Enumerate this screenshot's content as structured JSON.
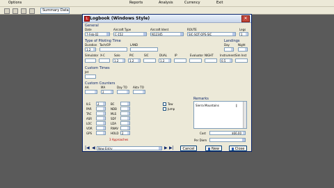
{
  "menubar": {
    "items": [
      "Options",
      "Reports",
      "Analysis",
      "Currency",
      "Exit"
    ]
  },
  "toolbar": {
    "combo_label": "Summary Data"
  },
  "dialog": {
    "title": "Logbook (Windows Style)",
    "general_title": "General",
    "fields": {
      "date_label": "Date",
      "date_value": "7-Feb-02",
      "aircraft_type_label": "Aircraft Type",
      "aircraft_type_value": "C-152",
      "aircraft_ident_label": "Aircraft Ident",
      "aircraft_ident_value": "N12345",
      "route_label": "ROUTE",
      "route_value": "SJC-SQT-OPS-SJC",
      "legs_label": "Legs",
      "legs_value": "1"
    },
    "pilot_time": {
      "title": "Type of Piloting Time",
      "landings_title": "Landings",
      "labels": [
        "Duration",
        "Tach/OP",
        "LAND",
        "Simulator",
        "X-C",
        "Solo",
        "PIC",
        "SIC",
        "DUAL",
        "IP",
        "Evaluator",
        "NIGHT",
        "Instrument",
        "Sim Inst",
        "Day",
        "Night"
      ],
      "values": {
        "duration": "1.2",
        "xc": "",
        "solo": "1.2",
        "pic": "1.2",
        "dual": "1.2",
        "instrument": "0.5",
        "day": "",
        "night": ""
      }
    },
    "custom_times": {
      "title": "Custom Times",
      "label": "Jet"
    },
    "custom_counters": {
      "title": "Custom Counters",
      "labels": [
        "AA",
        "MA",
        "Day TO",
        "Aktv TO"
      ],
      "values": {
        "ma": "2"
      }
    },
    "approaches": {
      "left": [
        {
          "label": "ILS",
          "value": "2"
        },
        {
          "label": "PAR",
          "value": ""
        },
        {
          "label": "TAC",
          "value": ""
        },
        {
          "label": "ASR",
          "value": ""
        },
        {
          "label": "LOC",
          "value": ""
        },
        {
          "label": "VOR",
          "value": ""
        },
        {
          "label": "GPS",
          "value": ""
        }
      ],
      "right": [
        {
          "label": "BC",
          "value": ""
        },
        {
          "label": "NDB",
          "value": ""
        },
        {
          "label": "MLS",
          "value": ""
        },
        {
          "label": "SDF",
          "value": ""
        },
        {
          "label": "LDA",
          "value": ""
        },
        {
          "label": "RNAV",
          "value": ""
        },
        {
          "label": "HOLD",
          "value": "2"
        }
      ],
      "summary": "3 Approaches"
    },
    "checks": {
      "tow": "Tow",
      "jump": "Jump"
    },
    "remarks": {
      "label": "Remarks",
      "text": "Sierra Mountains"
    },
    "cost": {
      "label": "Cost",
      "value": "$66.00"
    },
    "per_diem": {
      "label": "Per Diem"
    },
    "nav": {
      "first": "|◀",
      "prev": "◀",
      "next": "▶",
      "last": "▶|",
      "entry_value": "New Entry"
    },
    "buttons": {
      "cancel": "Cancel",
      "new": "New",
      "close": "Close"
    }
  }
}
